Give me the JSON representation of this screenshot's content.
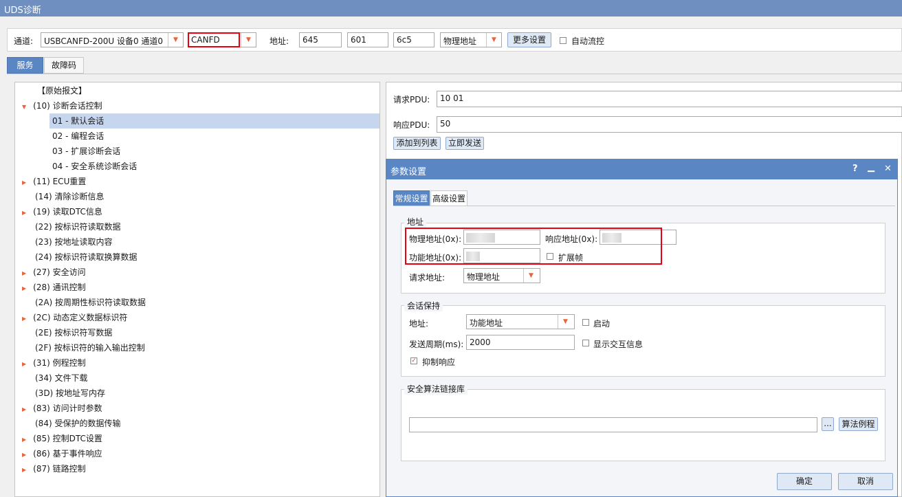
{
  "window": {
    "title": "UDS诊断"
  },
  "toolbar": {
    "channel_label": "通道:",
    "device_value": "USBCANFD-200U 设备0 通道0",
    "protocol_value": "CANFD",
    "address_label": "地址:",
    "addr1": "645",
    "addr2": "601",
    "addr3": "6c5",
    "addr_type": "物理地址",
    "more_settings": "更多设置",
    "auto_flow": "自动流控"
  },
  "tabs": [
    {
      "label": "服务"
    },
    {
      "label": "故障码"
    }
  ],
  "tree": {
    "root": "【原始报文】",
    "items": [
      {
        "label": "(10) 诊断会话控制",
        "arrow": "▼"
      },
      {
        "label": "01 - 默认会话",
        "selected": true
      },
      {
        "label": "02 - 编程会话"
      },
      {
        "label": "03 - 扩展诊断会话"
      },
      {
        "label": "04 - 安全系统诊断会话"
      },
      {
        "label": "(11) ECU重置",
        "arrow": "▶"
      },
      {
        "label": "(14) 清除诊断信息"
      },
      {
        "label": "(19) 读取DTC信息",
        "arrow": "▶"
      },
      {
        "label": "(22) 按标识符读取数据"
      },
      {
        "label": "(23) 按地址读取内容"
      },
      {
        "label": "(24) 按标识符读取换算数据"
      },
      {
        "label": "(27) 安全访问",
        "arrow": "▶"
      },
      {
        "label": "(28) 通讯控制",
        "arrow": "▶"
      },
      {
        "label": "(2A) 按周期性标识符读取数据"
      },
      {
        "label": "(2C) 动态定义数据标识符",
        "arrow": "▶"
      },
      {
        "label": "(2E) 按标识符写数据"
      },
      {
        "label": "(2F) 按标识符的输入输出控制"
      },
      {
        "label": "(31) 例程控制",
        "arrow": "▶"
      },
      {
        "label": "(34) 文件下载"
      },
      {
        "label": "(3D) 按地址写内存"
      },
      {
        "label": "(83) 访问计时参数",
        "arrow": "▶"
      },
      {
        "label": "(84) 受保护的数据传输"
      },
      {
        "label": "(85) 控制DTC设置",
        "arrow": "▶"
      },
      {
        "label": "(86) 基于事件响应",
        "arrow": "▶"
      },
      {
        "label": "(87) 链路控制",
        "arrow": "▶"
      }
    ]
  },
  "pdu": {
    "request_label": "请求PDU:",
    "request_value": "10 01",
    "response_label": "响应PDU:",
    "response_value": "50",
    "add_to_list": "添加到列表",
    "send_now": "立即发送"
  },
  "dialog": {
    "title": "参数设置",
    "help": "?",
    "minimize": "▁",
    "close": "✕",
    "tabs": [
      {
        "label": "常规设置"
      },
      {
        "label": "高级设置"
      }
    ],
    "address_group": {
      "title": "地址",
      "physical_label": "物理地址(0x):",
      "response_label": "响应地址(0x):",
      "functional_label": "功能地址(0x):",
      "ext_frame": "扩展帧",
      "request_addr_label": "请求地址:",
      "request_addr_value": "物理地址"
    },
    "session_group": {
      "title": "会话保持",
      "addr_label": "地址:",
      "addr_value": "功能地址",
      "enable": "启动",
      "period_label": "发送周期(ms):",
      "period_value": "2000",
      "show_interaction": "显示交互信息",
      "suppress_response": "抑制响应"
    },
    "security_group": {
      "title": "安全算法链接库",
      "path_value": "",
      "browse": "...",
      "example": "算法例程"
    },
    "ok": "确定",
    "cancel": "取消"
  }
}
